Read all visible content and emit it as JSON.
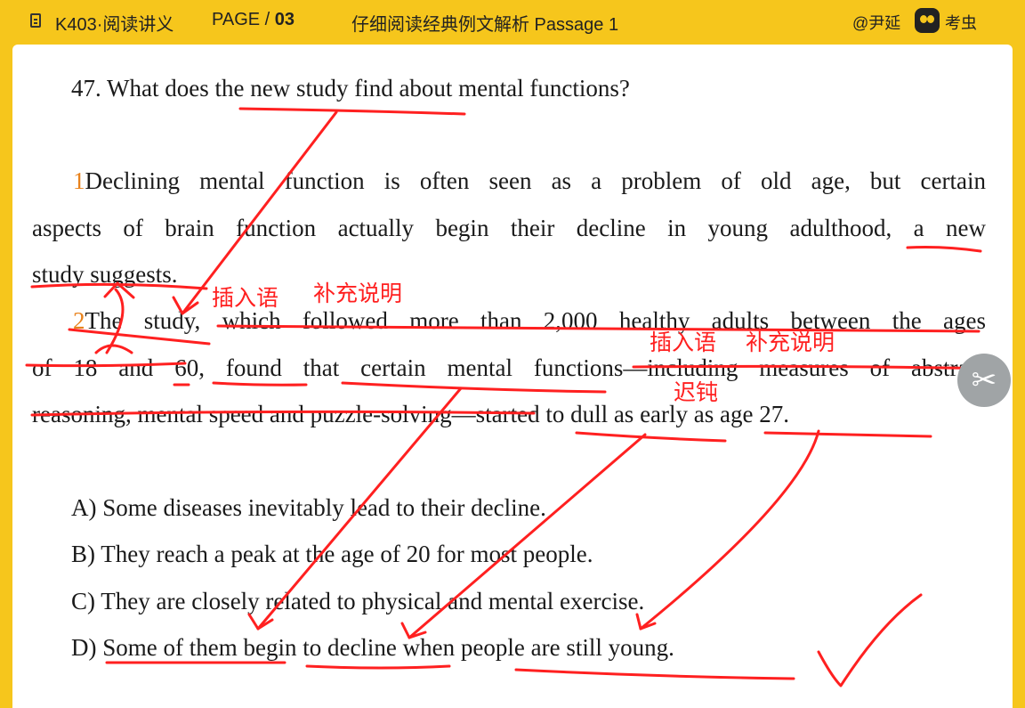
{
  "header": {
    "course": "K403·阅读讲义",
    "page_prefix": "PAGE / ",
    "page_number": "03",
    "subtitle": "仔细阅读经典例文解析 Passage 1",
    "author": "@尹延",
    "brand": "考虫"
  },
  "question": "47. What does the new study find about mental functions?",
  "paragraph1": {
    "number": "1",
    "lines": [
      "Declining mental function is often seen as a problem of old age, but certain",
      "aspects of brain function actually begin their decline in young adulthood, a new",
      "study suggests."
    ]
  },
  "paragraph2": {
    "number": "2",
    "lines": [
      "The study, which followed more than 2,000 healthy adults between the ages",
      "of 18 and 60, found that certain mental functions—including measures of abstract",
      "reasoning, mental speed and puzzle-solving—started to dull as early as age 27."
    ]
  },
  "options": [
    "A) Some diseases inevitably lead to their decline.",
    "B) They reach a peak at the age of 20 for most people.",
    "C) They are closely related to physical and mental exercise.",
    "D) Some of them begin to decline when people are still young."
  ],
  "annotations": {
    "insertion_1": "插入语",
    "supplement_1": "补充说明",
    "insertion_2": "插入语",
    "supplement_2": "补充说明",
    "dull_meaning": "迟钝"
  },
  "ink_color": "#ff2020"
}
